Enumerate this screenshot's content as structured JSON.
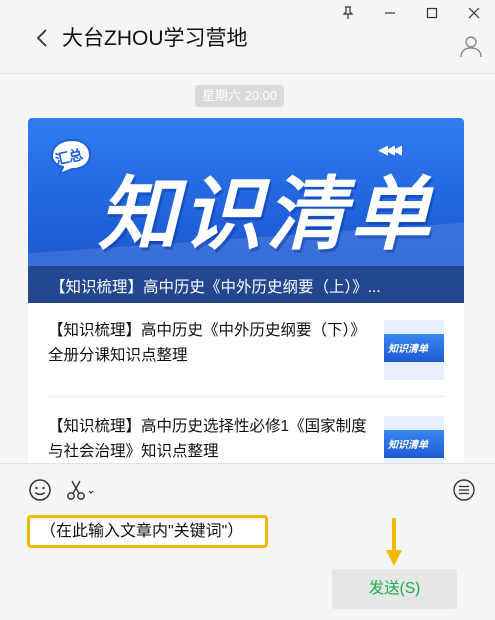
{
  "window": {
    "controls": [
      "pin",
      "minimize",
      "maximize",
      "close"
    ]
  },
  "header": {
    "title": "大台ZHOU学习营地",
    "back_icon": "chevron-left-icon",
    "profile_icon": "person-icon"
  },
  "chat": {
    "timestamp": "星期六 20:00",
    "card": {
      "cover": {
        "badge_text": "汇总",
        "banner_text": "知识清单",
        "caption": "【知识梳理】高中历史《中外历史纲要（上）》..."
      },
      "articles": [
        {
          "title": "【知识梳理】高中历史《中外历史纲要（下）》全册分课知识点整理",
          "thumb_text": "知识清单"
        },
        {
          "title": "【知识梳理】高中历史选择性必修1《国家制度与社会治理》知识点整理",
          "thumb_text": "知识清单"
        }
      ]
    }
  },
  "input": {
    "tools": [
      "emoji-icon",
      "scissors-icon",
      "chat-history-icon"
    ],
    "placeholder_text": "（在此输入文章内\"关键词\"）",
    "send_label": "发送(S)",
    "highlight_color": "#f2b800",
    "send_color": "#18b04b"
  }
}
